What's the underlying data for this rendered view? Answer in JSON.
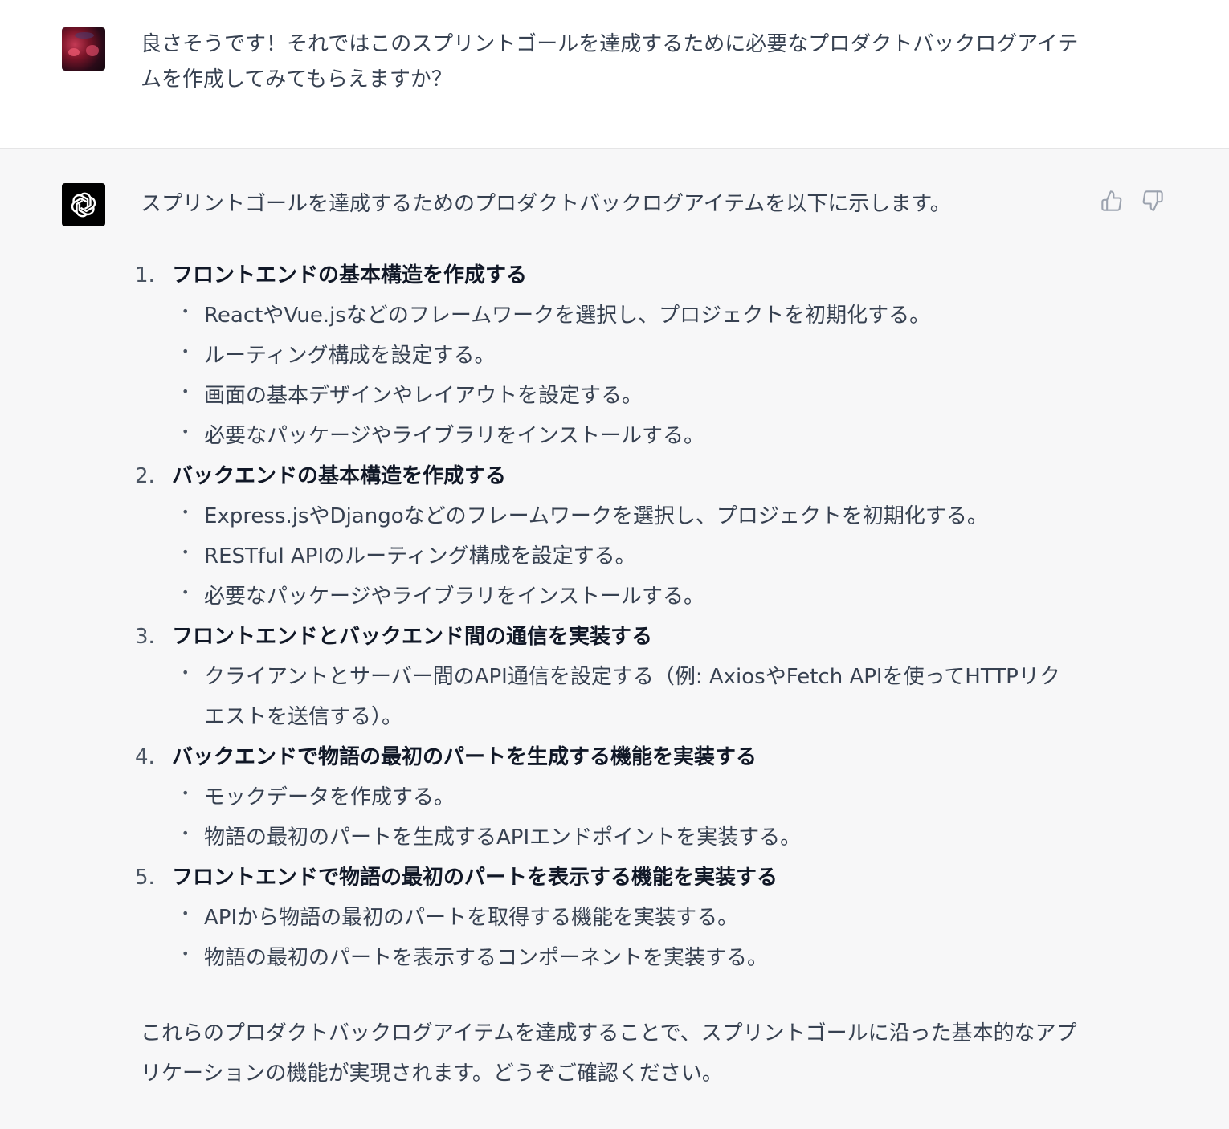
{
  "user_message": "良さそうです！それではこのスプリントゴールを達成するために必要なプロダクトバックログアイテムを作成してみてもらえますか？",
  "assistant": {
    "intro": "スプリントゴールを達成するためのプロダクトバックログアイテムを以下に示します。",
    "items": [
      {
        "number": "1.",
        "title": "フロントエンドの基本構造を作成する",
        "subs": [
          "ReactやVue.jsなどのフレームワークを選択し、プロジェクトを初期化する。",
          "ルーティング構成を設定する。",
          "画面の基本デザインやレイアウトを設定する。",
          "必要なパッケージやライブラリをインストールする。"
        ]
      },
      {
        "number": "2.",
        "title": "バックエンドの基本構造を作成する",
        "subs": [
          "Express.jsやDjangoなどのフレームワークを選択し、プロジェクトを初期化する。",
          "RESTful APIのルーティング構成を設定する。",
          "必要なパッケージやライブラリをインストールする。"
        ]
      },
      {
        "number": "3.",
        "title": "フロントエンドとバックエンド間の通信を実装する",
        "subs": [
          "クライアントとサーバー間のAPI通信を設定する（例: AxiosやFetch APIを使ってHTTPリクエストを送信する）。"
        ]
      },
      {
        "number": "4.",
        "title": "バックエンドで物語の最初のパートを生成する機能を実装する",
        "subs": [
          "モックデータを作成する。",
          "物語の最初のパートを生成するAPIエンドポイントを実装する。"
        ]
      },
      {
        "number": "5.",
        "title": "フロントエンドで物語の最初のパートを表示する機能を実装する",
        "subs": [
          "APIから物語の最初のパートを取得する機能を実装する。",
          "物語の最初のパートを表示するコンポーネントを実装する。"
        ]
      }
    ],
    "outro": "これらのプロダクトバックログアイテムを達成することで、スプリントゴールに沿った基本的なアプリケーションの機能が実現されます。どうぞご確認ください。"
  },
  "icons": {
    "user_avatar": "user-avatar-photo",
    "assistant_avatar": "openai-logo-icon",
    "thumbs_up": "thumbs-up-icon",
    "thumbs_down": "thumbs-down-icon"
  },
  "colors": {
    "user_bg": "#ffffff",
    "assistant_bg": "#f7f7f8",
    "text": "#374151",
    "icon": "#9ca3af"
  }
}
